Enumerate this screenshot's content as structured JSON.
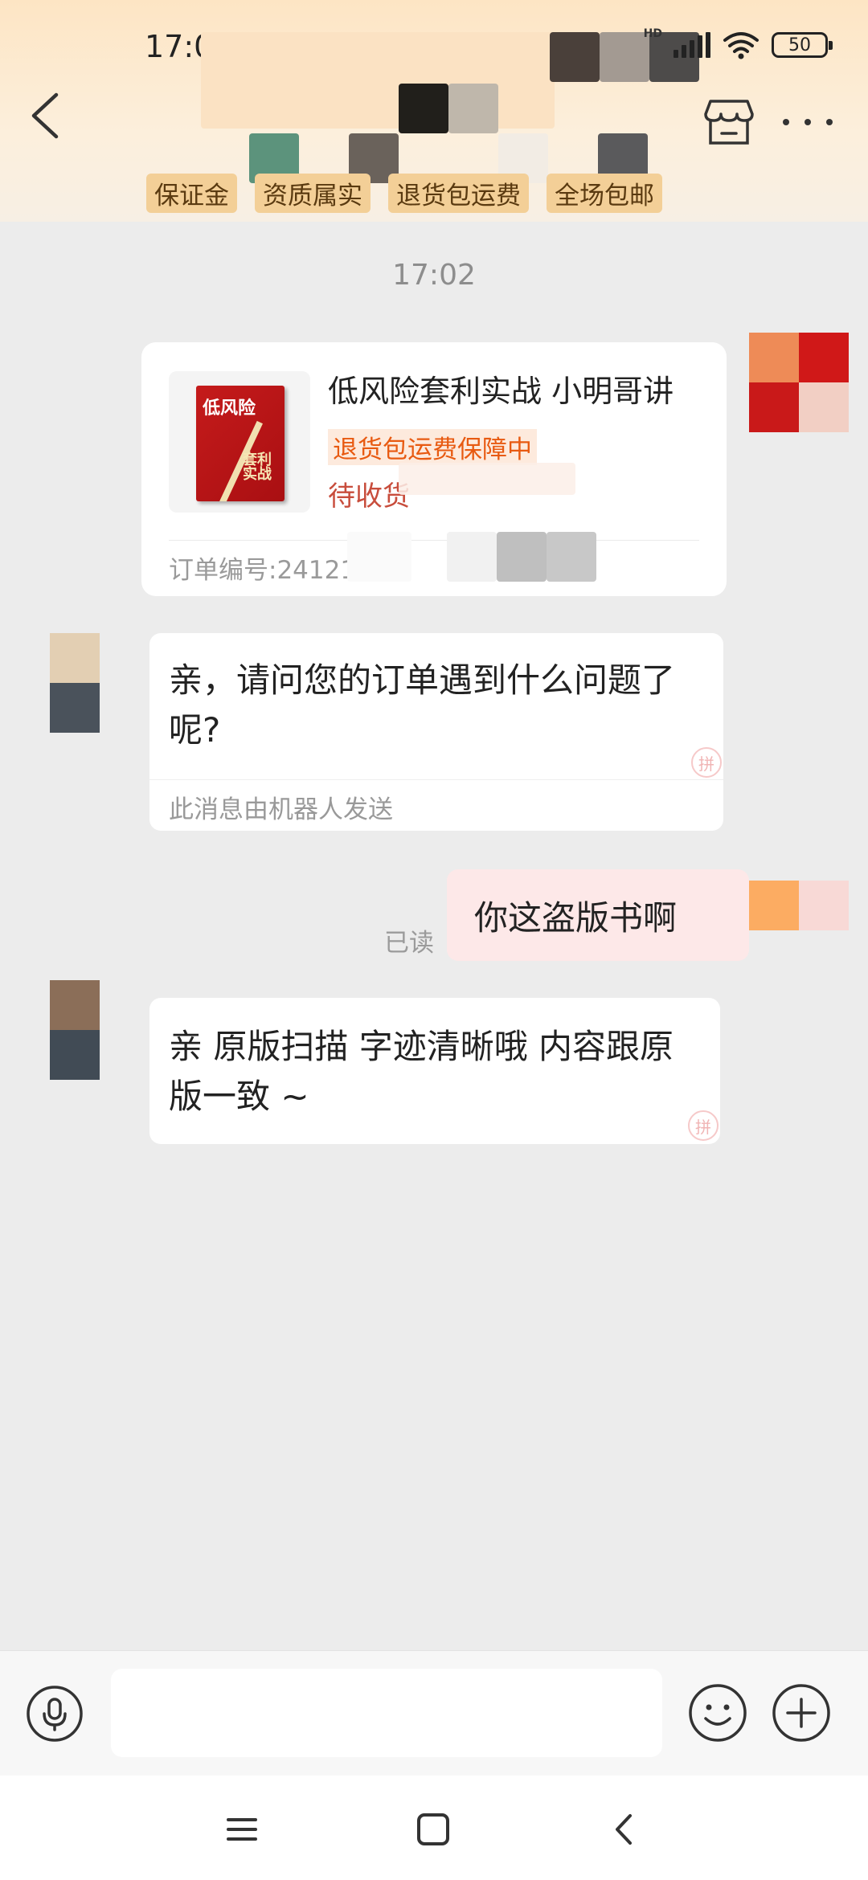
{
  "status_bar": {
    "time": "17:08",
    "network": "HD",
    "battery": "50"
  },
  "header": {
    "tags": [
      "保证金",
      "资质属实",
      "退货包运费",
      "全场包邮"
    ]
  },
  "chat": {
    "timestamp": "17:02",
    "order_card": {
      "book_cover_title": "低风险",
      "book_cover_subtitle": "套利实战",
      "title": "低风险套利实战 小明哥讲",
      "badge": "退货包运费保障中",
      "status": "待收货",
      "order_number": "订单编号:24121"
    },
    "messages": [
      {
        "from": "seller",
        "text": "亲，请问您的订单遇到什么问题了呢?",
        "note": "此消息由机器人发送"
      },
      {
        "from": "me",
        "text": "你这盗版书啊",
        "read": "已读"
      },
      {
        "from": "seller",
        "text": "亲 原版扫描 字迹清晰哦 内容跟原版一致 ~"
      }
    ]
  },
  "input_bar": {
    "value": "",
    "placeholder": ""
  },
  "colors": {
    "accent": "#e85a11",
    "tag_bg": "#f3cf97",
    "my_bubble": "#fde8e8",
    "chat_bg": "#ececec"
  },
  "icons": {
    "back": "chevron-left-icon",
    "store": "store-icon",
    "more": "more-dots-icon",
    "voice": "microphone-icon",
    "emoji": "emoji-icon",
    "plus": "plus-icon",
    "nav_menu": "menu-icon",
    "nav_home": "home-square-icon",
    "nav_back": "nav-back-icon"
  }
}
